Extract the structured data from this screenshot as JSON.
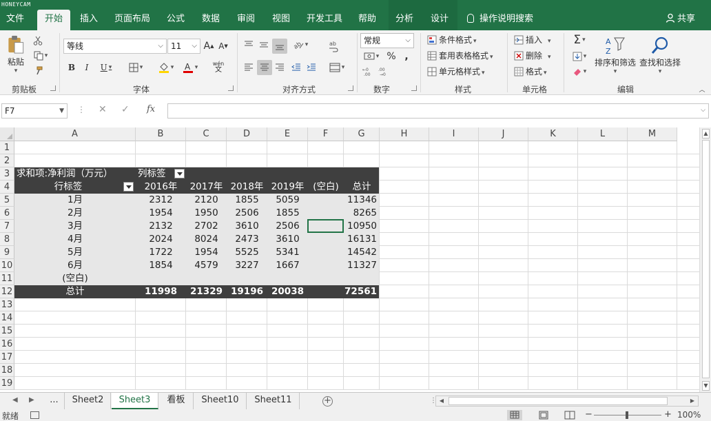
{
  "watermark": "HONEYCAM",
  "ribbon_tabs": [
    {
      "label": "文件"
    },
    {
      "label": "开始"
    },
    {
      "label": "插入"
    },
    {
      "label": "页面布局"
    },
    {
      "label": "公式"
    },
    {
      "label": "数据"
    },
    {
      "label": "审阅"
    },
    {
      "label": "视图"
    },
    {
      "label": "开发工具"
    },
    {
      "label": "帮助"
    },
    {
      "label": "分析"
    },
    {
      "label": "设计"
    }
  ],
  "active_tab": "开始",
  "tell_me": "操作说明搜索",
  "share": "共享",
  "ribbon": {
    "clipboard": {
      "paste": "粘贴",
      "label": "剪贴板"
    },
    "font": {
      "name": "等线",
      "size": "11",
      "bold": "B",
      "italic": "I",
      "underline": "U",
      "grow": "A",
      "shrink": "A",
      "phonetic": "wén",
      "label": "字体"
    },
    "alignment": {
      "label": "对齐方式"
    },
    "number": {
      "format": "常规",
      "percent": "%",
      "comma": ",",
      "label": "数字"
    },
    "styles": {
      "conditional": "条件格式",
      "table": "套用表格格式",
      "cell": "单元格样式",
      "label": "样式"
    },
    "cells": {
      "insert": "插入",
      "delete": "删除",
      "format": "格式",
      "label": "单元格"
    },
    "editing": {
      "sort": "排序和筛选",
      "find": "查找和选择",
      "label": "编辑"
    }
  },
  "formula_bar": {
    "name_box": "F7",
    "fx": "fx",
    "formula": ""
  },
  "columns": [
    "A",
    "B",
    "C",
    "D",
    "E",
    "F",
    "G",
    "H",
    "I",
    "J",
    "K",
    "L",
    "M"
  ],
  "rows": [
    "1",
    "2",
    "3",
    "4",
    "5",
    "6",
    "7",
    "8",
    "9",
    "10",
    "11",
    "12",
    "13",
    "14",
    "15",
    "16",
    "17",
    "18",
    "19"
  ],
  "pivot": {
    "value_field": "求和项:净利润（万元）",
    "column_labels": "列标签",
    "row_labels": "行标签",
    "headers": [
      "2016年",
      "2017年",
      "2018年",
      "2019年",
      "(空白)",
      "总计"
    ],
    "data_rows": [
      {
        "label": "1月",
        "values": [
          "2312",
          "2120",
          "1855",
          "5059",
          "",
          "11346"
        ]
      },
      {
        "label": "2月",
        "values": [
          "1954",
          "1950",
          "2506",
          "1855",
          "",
          "8265"
        ]
      },
      {
        "label": "3月",
        "values": [
          "2132",
          "2702",
          "3610",
          "2506",
          "",
          "10950"
        ]
      },
      {
        "label": "4月",
        "values": [
          "2024",
          "8024",
          "2473",
          "3610",
          "",
          "16131"
        ]
      },
      {
        "label": "5月",
        "values": [
          "1722",
          "1954",
          "5525",
          "5341",
          "",
          "14542"
        ]
      },
      {
        "label": "6月",
        "values": [
          "1854",
          "4579",
          "3227",
          "1667",
          "",
          "11327"
        ]
      },
      {
        "label": "(空白)",
        "values": [
          "",
          "",
          "",
          "",
          "",
          ""
        ]
      }
    ],
    "total_row": {
      "label": "总计",
      "values": [
        "11998",
        "21329",
        "19196",
        "20038",
        "",
        "72561"
      ]
    }
  },
  "sheets": {
    "ellipsis": "...",
    "tabs": [
      "Sheet2",
      "Sheet3",
      "看板",
      "Sheet10",
      "Sheet11"
    ],
    "active": "Sheet3"
  },
  "status": {
    "ready": "就绪",
    "zoom": "100%",
    "minus": "−",
    "plus": "+"
  },
  "colors": {
    "accent": "#217346",
    "pivot_dark": "#3f3f3f",
    "pivot_light": "#e7e7e7"
  }
}
